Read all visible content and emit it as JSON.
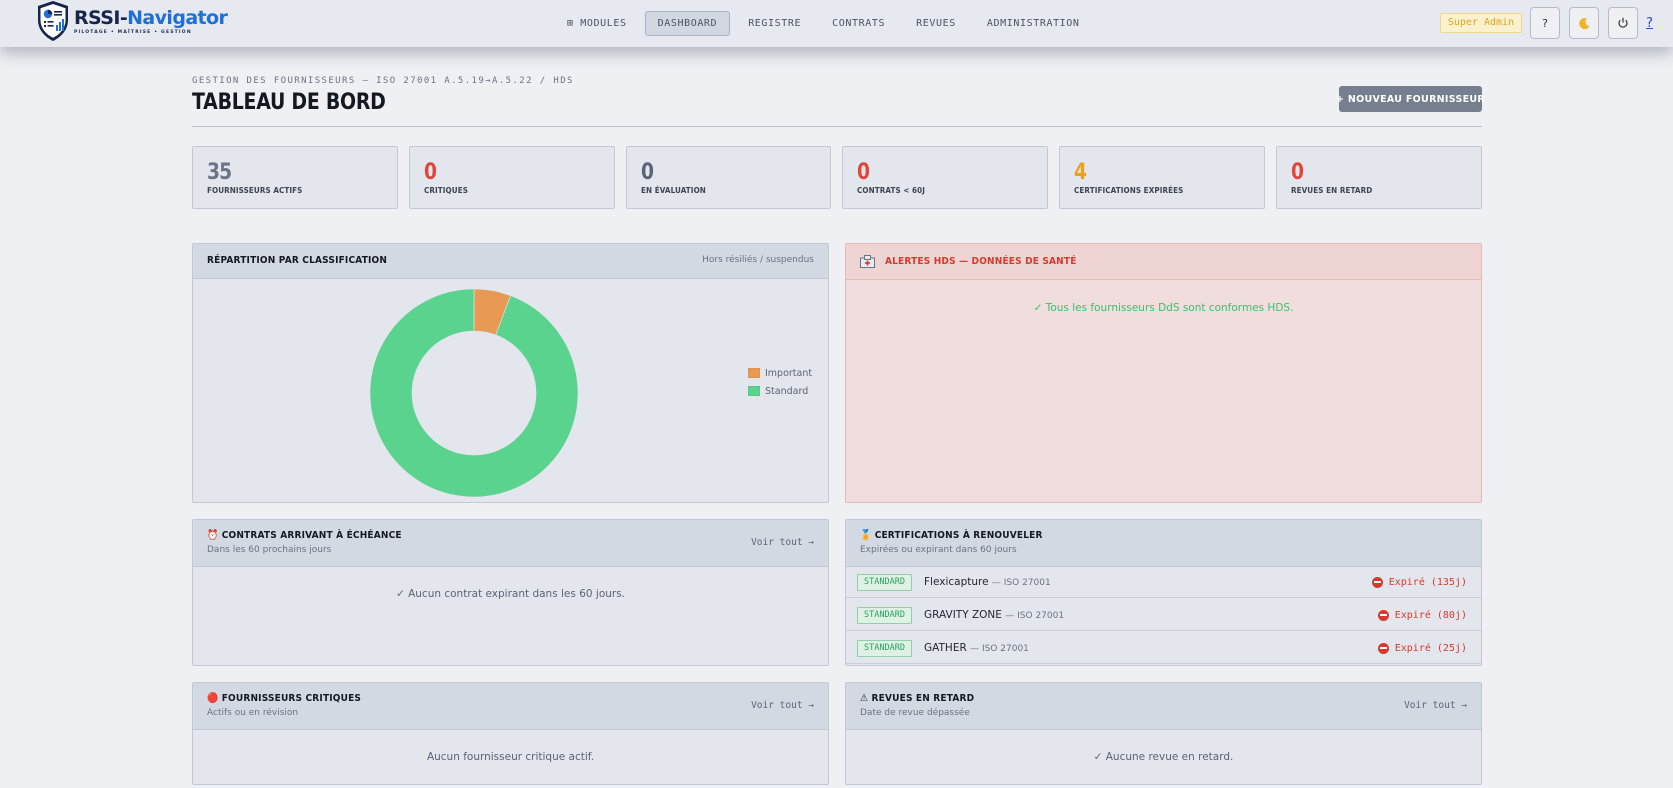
{
  "app": {
    "logo": {
      "name_part1": "RSSI-",
      "name_part2": "Navigator",
      "tagline": "PILOTAGE • MAÎTRISE • GESTION"
    }
  },
  "nav": {
    "items": [
      {
        "label": "⊞ MODULES",
        "active": false
      },
      {
        "label": "DASHBOARD",
        "active": true
      },
      {
        "label": "REGISTRE",
        "active": false
      },
      {
        "label": "CONTRATS",
        "active": false
      },
      {
        "label": "REVUES",
        "active": false
      },
      {
        "label": "ADMINISTRATION",
        "active": false
      }
    ]
  },
  "toolbar": {
    "role_badge": "Super Admin",
    "help_button": "?",
    "theme_icon": "moon-icon",
    "power_icon": "power-icon",
    "help_link": "?"
  },
  "header": {
    "breadcrumb": "GESTION DES FOURNISSEURS — ISO 27001 A.5.19→A.5.22 / HDS",
    "title": "TABLEAU DE BORD",
    "new_button": "+ NOUVEAU FOURNISSEUR"
  },
  "kpis": [
    {
      "value": "35",
      "label": "FOURNISSEURS ACTIFS",
      "color": "#6b7587"
    },
    {
      "value": "0",
      "label": "CRITIQUES",
      "color": "#e0463a"
    },
    {
      "value": "0",
      "label": "EN ÉVALUATION",
      "color": "#5a6476"
    },
    {
      "value": "0",
      "label": "CONTRATS < 60J",
      "color": "#e0463a"
    },
    {
      "value": "4",
      "label": "CERTIFICATIONS EXPIRÉES",
      "color": "#eba21a"
    },
    {
      "value": "0",
      "label": "REVUES EN RETARD",
      "color": "#e0463a"
    }
  ],
  "classification": {
    "title": "RÉPARTITION PAR CLASSIFICATION",
    "note": "Hors résiliés / suspendus",
    "chart_data": {
      "type": "pie",
      "categories": [
        "Important",
        "Standard"
      ],
      "values": [
        2,
        33
      ],
      "colors": [
        "#e89a55",
        "#59d38e"
      ],
      "legend": "right"
    }
  },
  "hds_alerts": {
    "icon": "hospital-icon",
    "title": "ALERTES HDS — DONNÉES DE SANTÉ",
    "message": "✓ Tous les fournisseurs DdS sont conformes HDS.",
    "message_color": "#36c26d"
  },
  "contracts": {
    "icon": "alarm-clock-icon",
    "title": "⏰ CONTRATS ARRIVANT À ÉCHÉANCE",
    "subtitle": "Dans les 60 prochains jours",
    "link": "Voir tout →",
    "empty": "✓ Aucun contrat expirant dans les 60 jours."
  },
  "certifications": {
    "icon": "medal-icon",
    "title": "🏅 CERTIFICATIONS À RENOUVELER",
    "subtitle": "Expirées ou expirant dans 60 jours",
    "rows": [
      {
        "tag": "STANDARD",
        "name": "Flexicapture",
        "standard": "— ISO 27001",
        "status": "Expiré (135j)"
      },
      {
        "tag": "STANDARD",
        "name": "GRAVITY ZONE",
        "standard": "— ISO 27001",
        "status": "Expiré (80j)"
      },
      {
        "tag": "STANDARD",
        "name": "GATHER",
        "standard": "— ISO 27001",
        "status": "Expiré (25j)"
      }
    ]
  },
  "critical_suppliers": {
    "icon": "red-circle-icon",
    "title": "🔴 FOURNISSEURS CRITIQUES",
    "subtitle": "Actifs ou en révision",
    "link": "Voir tout →",
    "empty": "Aucun fournisseur critique actif."
  },
  "late_reviews": {
    "icon": "warning-icon",
    "title": "⚠ REVUES EN RETARD",
    "subtitle": "Date de revue dépassée",
    "link": "Voir tout →",
    "empty": "✓ Aucune revue en retard."
  }
}
